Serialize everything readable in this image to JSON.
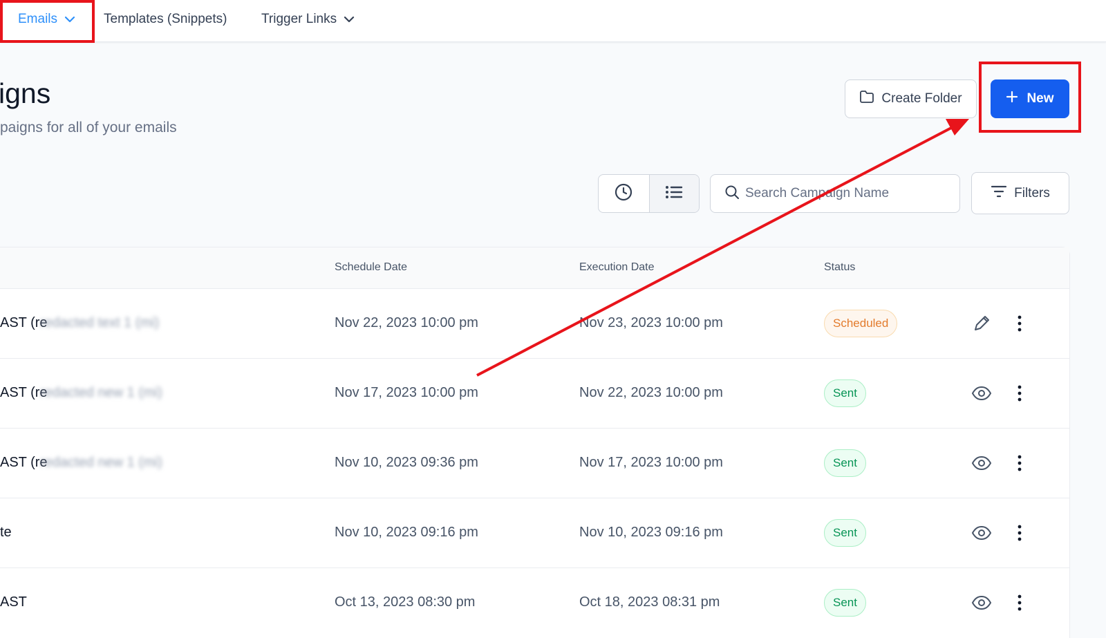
{
  "nav": {
    "emails": "Emails",
    "templates": "Templates (Snippets)",
    "trigger_links": "Trigger Links"
  },
  "page": {
    "title": "igns",
    "subtitle": "paigns for all of your emails"
  },
  "actions": {
    "create_folder": "Create Folder",
    "new": "New"
  },
  "search": {
    "placeholder": "Search Campaign Name"
  },
  "filters_label": "Filters",
  "table": {
    "columns": [
      "Schedule Date",
      "Execution Date",
      "Status"
    ],
    "rows": [
      {
        "name": "AST (re",
        "name_blur": "redacted text 1 (mi)",
        "schedule": "Nov 22, 2023 10:00 pm",
        "execution": "Nov 23, 2023 10:00 pm",
        "status": "Scheduled",
        "status_kind": "scheduled",
        "action_icon": "pencil-icon"
      },
      {
        "name": "AST (re",
        "name_blur": "redacted new 1 (mi)",
        "schedule": "Nov 17, 2023 10:00 pm",
        "execution": "Nov 22, 2023 10:00 pm",
        "status": "Sent",
        "status_kind": "sent",
        "action_icon": "eye-icon"
      },
      {
        "name": "AST (re",
        "name_blur": "redacted new 1 (mi)",
        "schedule": "Nov 10, 2023 09:36 pm",
        "execution": "Nov 17, 2023 10:00 pm",
        "status": "Sent",
        "status_kind": "sent",
        "action_icon": "eye-icon"
      },
      {
        "name": "te",
        "name_blur": "",
        "schedule": "Nov 10, 2023 09:16 pm",
        "execution": "Nov 10, 2023 09:16 pm",
        "status": "Sent",
        "status_kind": "sent",
        "action_icon": "eye-icon"
      },
      {
        "name": "AST",
        "name_blur": "",
        "schedule": "Oct 13, 2023 08:30 pm",
        "execution": "Oct 18, 2023 08:31 pm",
        "status": "Sent",
        "status_kind": "sent",
        "action_icon": "eye-icon"
      }
    ]
  },
  "colors": {
    "accent": "#2e90fa",
    "primary_button": "#155eef",
    "annotation": "#e8141b"
  }
}
